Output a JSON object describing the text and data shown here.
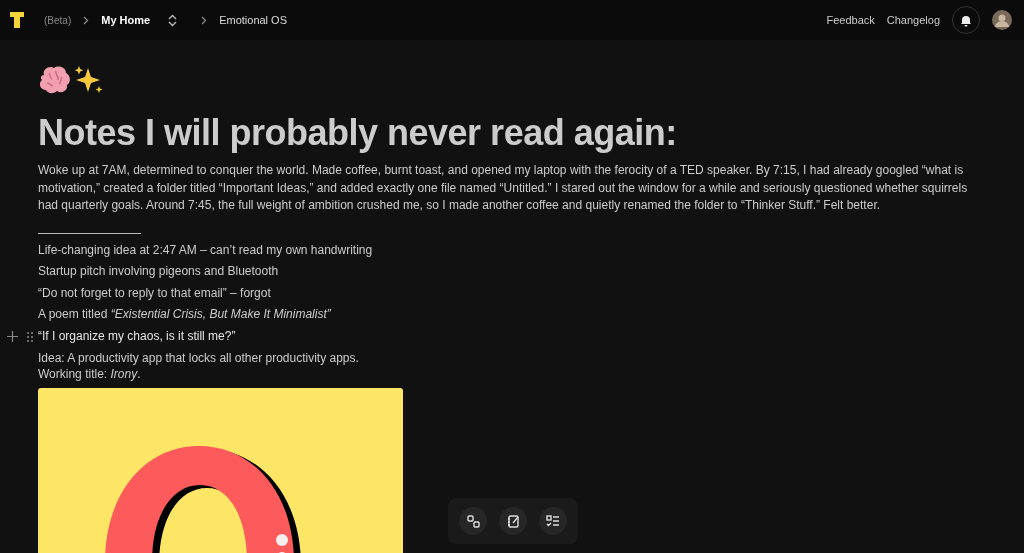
{
  "topbar": {
    "beta": "(Beta)",
    "breadcrumbs": [
      {
        "label": "My Home",
        "current": true
      },
      {
        "label": "Emotional OS",
        "current": false
      }
    ],
    "links": [
      "Feedback",
      "Changelog"
    ]
  },
  "page": {
    "title": "Notes I will probably never read again:",
    "paragraph": "Woke up at 7AM, determined to conquer the world. Made coffee, burnt toast, and opened my laptop with the ferocity of a TED speaker. By 7:15, I had already googled “what is motivation,” created a folder titled “Important Ideas,” and added exactly one file named “Untitled.” I stared out the window for a while and seriously questioned whether squirrels had quarterly goals. Around 7:45, the full weight of ambition crushed me, so I made another coffee and quietly renamed the folder to “Thinker Stuff.” Felt better.",
    "items": [
      {
        "text": "Life-changing idea at 2:47 AM – can’t read my own handwriting",
        "hovered": false
      },
      {
        "text": "Startup pitch involving pigeons and Bluetooth",
        "hovered": false
      },
      {
        "text": "“Do not forget to reply to that email” – forgot",
        "hovered": false
      },
      {
        "text": "A poem titled *“Existential Crisis, But Make It Minimalist”*",
        "hovered": false
      },
      {
        "text": "“If I organize my chaos, is it still me?”",
        "hovered": true
      }
    ],
    "closing": [
      "Idea: A productivity app that locks all other productivity apps.",
      "Working title: *Irony*."
    ]
  }
}
